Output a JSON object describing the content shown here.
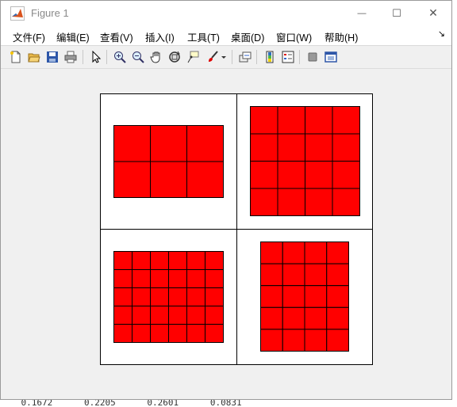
{
  "window": {
    "title": "Figure 1",
    "minimize_glyph": "—",
    "maximize_glyph": "☐",
    "close_glyph": "✕"
  },
  "menu": {
    "items": [
      {
        "label": "文件(F)"
      },
      {
        "label": "编辑(E)"
      },
      {
        "label": "查看(V)"
      },
      {
        "label": "插入(I)"
      },
      {
        "label": "工具(T)"
      },
      {
        "label": "桌面(D)"
      },
      {
        "label": "窗口(W)"
      },
      {
        "label": "帮助(H)"
      }
    ],
    "overflow_glyph": "↘"
  },
  "toolbar": {
    "buttons": [
      {
        "icon": "new-figure-icon"
      },
      {
        "icon": "open-folder-icon"
      },
      {
        "icon": "save-icon"
      },
      {
        "icon": "print-icon"
      },
      {
        "icon": "edit-plot-pointer-icon"
      },
      {
        "icon": "zoom-in-icon"
      },
      {
        "icon": "zoom-out-icon"
      },
      {
        "icon": "pan-hand-icon"
      },
      {
        "icon": "rotate-3d-icon"
      },
      {
        "icon": "data-cursor-icon"
      },
      {
        "icon": "brush-icon"
      },
      {
        "icon": "link-plot-icon"
      },
      {
        "icon": "insert-colorbar-icon"
      },
      {
        "icon": "insert-legend-icon"
      },
      {
        "icon": "hide-plot-tools-icon"
      },
      {
        "icon": "show-plot-tools-icon"
      }
    ]
  },
  "colors": {
    "cell_fill": "#ff0000",
    "cell_edge": "#000000",
    "axes_bg": "#ffffff",
    "figure_bg": "#f0f0f0"
  },
  "figure": {
    "subplots": [
      {
        "rows": 2,
        "cols": 3
      },
      {
        "rows": 4,
        "cols": 4
      },
      {
        "rows": 5,
        "cols": 6
      },
      {
        "rows": 5,
        "cols": 4
      }
    ]
  },
  "background_text": "    0.1672      0.2205      0.2601      0.0831"
}
